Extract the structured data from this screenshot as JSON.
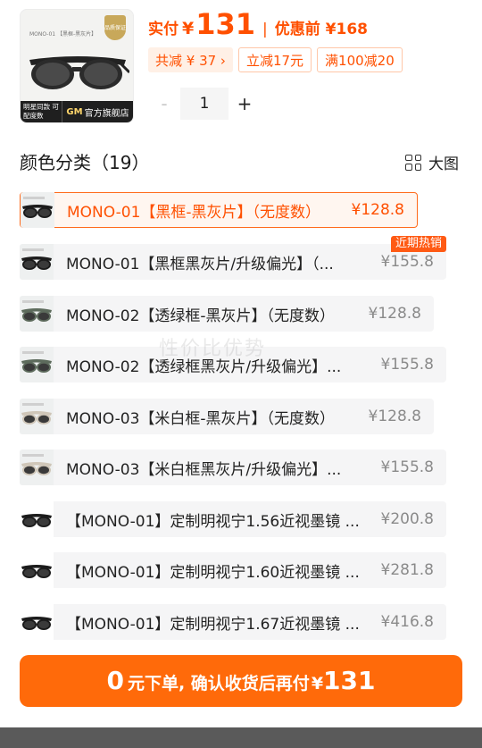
{
  "header": {
    "thumb_small_text": "MONO-01 【黑框-黑灰片】",
    "thumb_badge": "品质保证",
    "thumb_corner_left": "明星同款 可配度数",
    "thumb_corner_brand": "GM",
    "thumb_corner_store": "官方旗舰店",
    "actual_label": "实付",
    "currency": "¥",
    "actual_price": "131",
    "separator": "|",
    "orig_label": "优惠前 ¥168",
    "tags": [
      "共减 ¥ 37 ›",
      "立减17元",
      "满100减20"
    ],
    "qty_minus": "-",
    "qty_value": "1",
    "qty_plus": "+"
  },
  "section": {
    "title": "颜色分类（19）",
    "big_view_label": "大图"
  },
  "watermark": "性价比优势",
  "options": [
    {
      "name": "MONO-01【黑框-黑灰片】（无度数）",
      "price": "¥128.8",
      "selected": true,
      "thumb": "dark"
    },
    {
      "name": "MONO-01【黑框黑灰片/升级偏光】（...",
      "price": "¥155.8",
      "hot": "近期热销",
      "thumb": "dark"
    },
    {
      "name": "MONO-02【透绿框-黑灰片】（无度数）",
      "price": "¥128.8",
      "thumb": "green"
    },
    {
      "name": "MONO-02【透绿框黑灰片/升级偏光】...",
      "price": "¥155.8",
      "thumb": "green"
    },
    {
      "name": "MONO-03【米白框-黑灰片】（无度数）",
      "price": "¥128.8",
      "thumb": "cream"
    },
    {
      "name": "MONO-03【米白框黑灰片/升级偏光】...",
      "price": "¥155.8",
      "thumb": "cream"
    },
    {
      "name": "【MONO-01】定制明视宁1.56近视墨镜 ...",
      "price": "¥200.8",
      "thumb": "plain"
    },
    {
      "name": "【MONO-01】定制明视宁1.60近视墨镜 ...",
      "price": "¥281.8",
      "thumb": "plain"
    },
    {
      "name": "【MONO-01】定制明视宁1.67近视墨镜 ...",
      "price": "¥416.8",
      "thumb": "plain"
    }
  ],
  "cta": {
    "zero": "0",
    "text": "元下单, 确认收货后再付",
    "currency": "¥",
    "price": "131"
  },
  "colors": {
    "accent": "#ff5000",
    "button": "#ff6a0a",
    "tag_bg": "#fff0e6",
    "row_bg": "#f5f5f6",
    "selected_border": "#ff6a1a"
  }
}
